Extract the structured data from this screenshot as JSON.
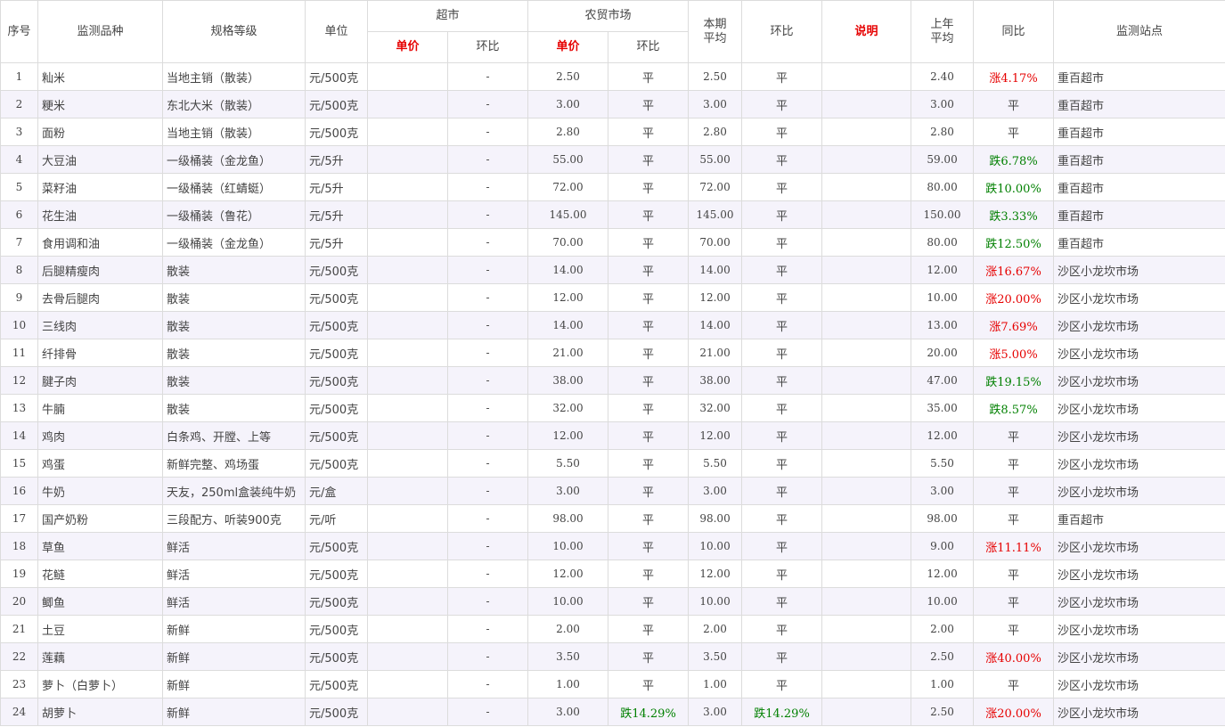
{
  "table": {
    "headers": {
      "seq": "序号",
      "item": "监测品种",
      "spec": "规格等级",
      "unit": "单位",
      "supermarket": "超市",
      "farmers_market": "农贸市场",
      "current_avg": "本期平均",
      "mom": "环比",
      "remark": "说明",
      "last_year_avg": "上年平均",
      "yoy": "同比",
      "station": "监测站点",
      "sub_unit_price": "单价",
      "sub_mom": "环比"
    },
    "rows": [
      {
        "seq": "1",
        "item": "籼米",
        "spec": "当地主销（散装）",
        "unit": "元/500克",
        "sm_price": "",
        "sm_mom": "-",
        "fm_price": "2.50",
        "fm_mom": "平",
        "fm_mom_dir": "flat",
        "avg": "2.50",
        "mom": "平",
        "mom_dir": "flat",
        "remark": "",
        "ly_avg": "2.40",
        "yoy": "涨4.17%",
        "yoy_dir": "up",
        "station": "重百超市"
      },
      {
        "seq": "2",
        "item": "粳米",
        "spec": "东北大米（散装）",
        "unit": "元/500克",
        "sm_price": "",
        "sm_mom": "-",
        "fm_price": "3.00",
        "fm_mom": "平",
        "fm_mom_dir": "flat",
        "avg": "3.00",
        "mom": "平",
        "mom_dir": "flat",
        "remark": "",
        "ly_avg": "3.00",
        "yoy": "平",
        "yoy_dir": "flat",
        "station": "重百超市"
      },
      {
        "seq": "3",
        "item": "面粉",
        "spec": "当地主销（散装）",
        "unit": "元/500克",
        "sm_price": "",
        "sm_mom": "-",
        "fm_price": "2.80",
        "fm_mom": "平",
        "fm_mom_dir": "flat",
        "avg": "2.80",
        "mom": "平",
        "mom_dir": "flat",
        "remark": "",
        "ly_avg": "2.80",
        "yoy": "平",
        "yoy_dir": "flat",
        "station": "重百超市"
      },
      {
        "seq": "4",
        "item": "大豆油",
        "spec": "一级桶装（金龙鱼）",
        "unit": "元/5升",
        "sm_price": "",
        "sm_mom": "-",
        "fm_price": "55.00",
        "fm_mom": "平",
        "fm_mom_dir": "flat",
        "avg": "55.00",
        "mom": "平",
        "mom_dir": "flat",
        "remark": "",
        "ly_avg": "59.00",
        "yoy": "跌6.78%",
        "yoy_dir": "down",
        "station": "重百超市"
      },
      {
        "seq": "5",
        "item": "菜籽油",
        "spec": "一级桶装（红蜻蜓）",
        "unit": "元/5升",
        "sm_price": "",
        "sm_mom": "-",
        "fm_price": "72.00",
        "fm_mom": "平",
        "fm_mom_dir": "flat",
        "avg": "72.00",
        "mom": "平",
        "mom_dir": "flat",
        "remark": "",
        "ly_avg": "80.00",
        "yoy": "跌10.00%",
        "yoy_dir": "down",
        "station": "重百超市"
      },
      {
        "seq": "6",
        "item": "花生油",
        "spec": "一级桶装（鲁花）",
        "unit": "元/5升",
        "sm_price": "",
        "sm_mom": "-",
        "fm_price": "145.00",
        "fm_mom": "平",
        "fm_mom_dir": "flat",
        "avg": "145.00",
        "mom": "平",
        "mom_dir": "flat",
        "remark": "",
        "ly_avg": "150.00",
        "yoy": "跌3.33%",
        "yoy_dir": "down",
        "station": "重百超市"
      },
      {
        "seq": "7",
        "item": "食用调和油",
        "spec": "一级桶装（金龙鱼）",
        "unit": "元/5升",
        "sm_price": "",
        "sm_mom": "-",
        "fm_price": "70.00",
        "fm_mom": "平",
        "fm_mom_dir": "flat",
        "avg": "70.00",
        "mom": "平",
        "mom_dir": "flat",
        "remark": "",
        "ly_avg": "80.00",
        "yoy": "跌12.50%",
        "yoy_dir": "down",
        "station": "重百超市"
      },
      {
        "seq": "8",
        "item": "后腿精瘦肉",
        "spec": "散装",
        "unit": "元/500克",
        "sm_price": "",
        "sm_mom": "-",
        "fm_price": "14.00",
        "fm_mom": "平",
        "fm_mom_dir": "flat",
        "avg": "14.00",
        "mom": "平",
        "mom_dir": "flat",
        "remark": "",
        "ly_avg": "12.00",
        "yoy": "涨16.67%",
        "yoy_dir": "up",
        "station": "沙区小龙坎市场"
      },
      {
        "seq": "9",
        "item": "去骨后腿肉",
        "spec": "散装",
        "unit": "元/500克",
        "sm_price": "",
        "sm_mom": "-",
        "fm_price": "12.00",
        "fm_mom": "平",
        "fm_mom_dir": "flat",
        "avg": "12.00",
        "mom": "平",
        "mom_dir": "flat",
        "remark": "",
        "ly_avg": "10.00",
        "yoy": "涨20.00%",
        "yoy_dir": "up",
        "station": "沙区小龙坎市场"
      },
      {
        "seq": "10",
        "item": "三线肉",
        "spec": "散装",
        "unit": "元/500克",
        "sm_price": "",
        "sm_mom": "-",
        "fm_price": "14.00",
        "fm_mom": "平",
        "fm_mom_dir": "flat",
        "avg": "14.00",
        "mom": "平",
        "mom_dir": "flat",
        "remark": "",
        "ly_avg": "13.00",
        "yoy": "涨7.69%",
        "yoy_dir": "up",
        "station": "沙区小龙坎市场"
      },
      {
        "seq": "11",
        "item": "纤排骨",
        "spec": "散装",
        "unit": "元/500克",
        "sm_price": "",
        "sm_mom": "-",
        "fm_price": "21.00",
        "fm_mom": "平",
        "fm_mom_dir": "flat",
        "avg": "21.00",
        "mom": "平",
        "mom_dir": "flat",
        "remark": "",
        "ly_avg": "20.00",
        "yoy": "涨5.00%",
        "yoy_dir": "up",
        "station": "沙区小龙坎市场"
      },
      {
        "seq": "12",
        "item": "腱子肉",
        "spec": "散装",
        "unit": "元/500克",
        "sm_price": "",
        "sm_mom": "-",
        "fm_price": "38.00",
        "fm_mom": "平",
        "fm_mom_dir": "flat",
        "avg": "38.00",
        "mom": "平",
        "mom_dir": "flat",
        "remark": "",
        "ly_avg": "47.00",
        "yoy": "跌19.15%",
        "yoy_dir": "down",
        "station": "沙区小龙坎市场"
      },
      {
        "seq": "13",
        "item": "牛腩",
        "spec": "散装",
        "unit": "元/500克",
        "sm_price": "",
        "sm_mom": "-",
        "fm_price": "32.00",
        "fm_mom": "平",
        "fm_mom_dir": "flat",
        "avg": "32.00",
        "mom": "平",
        "mom_dir": "flat",
        "remark": "",
        "ly_avg": "35.00",
        "yoy": "跌8.57%",
        "yoy_dir": "down",
        "station": "沙区小龙坎市场"
      },
      {
        "seq": "14",
        "item": "鸡肉",
        "spec": "白条鸡、开膛、上等",
        "unit": "元/500克",
        "sm_price": "",
        "sm_mom": "-",
        "fm_price": "12.00",
        "fm_mom": "平",
        "fm_mom_dir": "flat",
        "avg": "12.00",
        "mom": "平",
        "mom_dir": "flat",
        "remark": "",
        "ly_avg": "12.00",
        "yoy": "平",
        "yoy_dir": "flat",
        "station": "沙区小龙坎市场"
      },
      {
        "seq": "15",
        "item": "鸡蛋",
        "spec": "新鲜完整、鸡场蛋",
        "unit": "元/500克",
        "sm_price": "",
        "sm_mom": "-",
        "fm_price": "5.50",
        "fm_mom": "平",
        "fm_mom_dir": "flat",
        "avg": "5.50",
        "mom": "平",
        "mom_dir": "flat",
        "remark": "",
        "ly_avg": "5.50",
        "yoy": "平",
        "yoy_dir": "flat",
        "station": "沙区小龙坎市场"
      },
      {
        "seq": "16",
        "item": "牛奶",
        "spec": "天友，250ml盒装纯牛奶",
        "unit": "元/盒",
        "sm_price": "",
        "sm_mom": "-",
        "fm_price": "3.00",
        "fm_mom": "平",
        "fm_mom_dir": "flat",
        "avg": "3.00",
        "mom": "平",
        "mom_dir": "flat",
        "remark": "",
        "ly_avg": "3.00",
        "yoy": "平",
        "yoy_dir": "flat",
        "station": "沙区小龙坎市场"
      },
      {
        "seq": "17",
        "item": "国产奶粉",
        "spec": "三段配方、听装900克",
        "unit": "元/听",
        "sm_price": "",
        "sm_mom": "-",
        "fm_price": "98.00",
        "fm_mom": "平",
        "fm_mom_dir": "flat",
        "avg": "98.00",
        "mom": "平",
        "mom_dir": "flat",
        "remark": "",
        "ly_avg": "98.00",
        "yoy": "平",
        "yoy_dir": "flat",
        "station": "重百超市"
      },
      {
        "seq": "18",
        "item": "草鱼",
        "spec": "鲜活",
        "unit": "元/500克",
        "sm_price": "",
        "sm_mom": "-",
        "fm_price": "10.00",
        "fm_mom": "平",
        "fm_mom_dir": "flat",
        "avg": "10.00",
        "mom": "平",
        "mom_dir": "flat",
        "remark": "",
        "ly_avg": "9.00",
        "yoy": "涨11.11%",
        "yoy_dir": "up",
        "station": "沙区小龙坎市场"
      },
      {
        "seq": "19",
        "item": "花鲢",
        "spec": "鲜活",
        "unit": "元/500克",
        "sm_price": "",
        "sm_mom": "-",
        "fm_price": "12.00",
        "fm_mom": "平",
        "fm_mom_dir": "flat",
        "avg": "12.00",
        "mom": "平",
        "mom_dir": "flat",
        "remark": "",
        "ly_avg": "12.00",
        "yoy": "平",
        "yoy_dir": "flat",
        "station": "沙区小龙坎市场"
      },
      {
        "seq": "20",
        "item": "鲫鱼",
        "spec": "鲜活",
        "unit": "元/500克",
        "sm_price": "",
        "sm_mom": "-",
        "fm_price": "10.00",
        "fm_mom": "平",
        "fm_mom_dir": "flat",
        "avg": "10.00",
        "mom": "平",
        "mom_dir": "flat",
        "remark": "",
        "ly_avg": "10.00",
        "yoy": "平",
        "yoy_dir": "flat",
        "station": "沙区小龙坎市场"
      },
      {
        "seq": "21",
        "item": "土豆",
        "spec": "新鲜",
        "unit": "元/500克",
        "sm_price": "",
        "sm_mom": "-",
        "fm_price": "2.00",
        "fm_mom": "平",
        "fm_mom_dir": "flat",
        "avg": "2.00",
        "mom": "平",
        "mom_dir": "flat",
        "remark": "",
        "ly_avg": "2.00",
        "yoy": "平",
        "yoy_dir": "flat",
        "station": "沙区小龙坎市场"
      },
      {
        "seq": "22",
        "item": "莲藕",
        "spec": "新鲜",
        "unit": "元/500克",
        "sm_price": "",
        "sm_mom": "-",
        "fm_price": "3.50",
        "fm_mom": "平",
        "fm_mom_dir": "flat",
        "avg": "3.50",
        "mom": "平",
        "mom_dir": "flat",
        "remark": "",
        "ly_avg": "2.50",
        "yoy": "涨40.00%",
        "yoy_dir": "up",
        "station": "沙区小龙坎市场"
      },
      {
        "seq": "23",
        "item": "萝卜（白萝卜）",
        "spec": "新鲜",
        "unit": "元/500克",
        "sm_price": "",
        "sm_mom": "-",
        "fm_price": "1.00",
        "fm_mom": "平",
        "fm_mom_dir": "flat",
        "avg": "1.00",
        "mom": "平",
        "mom_dir": "flat",
        "remark": "",
        "ly_avg": "1.00",
        "yoy": "平",
        "yoy_dir": "flat",
        "station": "沙区小龙坎市场"
      },
      {
        "seq": "24",
        "item": "胡萝卜",
        "spec": "新鲜",
        "unit": "元/500克",
        "sm_price": "",
        "sm_mom": "-",
        "fm_price": "3.00",
        "fm_mom": "跌14.29%",
        "fm_mom_dir": "down",
        "avg": "3.00",
        "mom": "跌14.29%",
        "mom_dir": "down",
        "remark": "",
        "ly_avg": "2.50",
        "yoy": "涨20.00%",
        "yoy_dir": "up",
        "station": "沙区小龙坎市场"
      }
    ]
  },
  "colors": {
    "up": "#e60000",
    "down": "#008000",
    "flat": "#444444",
    "header_accent": "#e60000",
    "row_alt": "#f5f3fb",
    "border": "#dcdcdc"
  }
}
